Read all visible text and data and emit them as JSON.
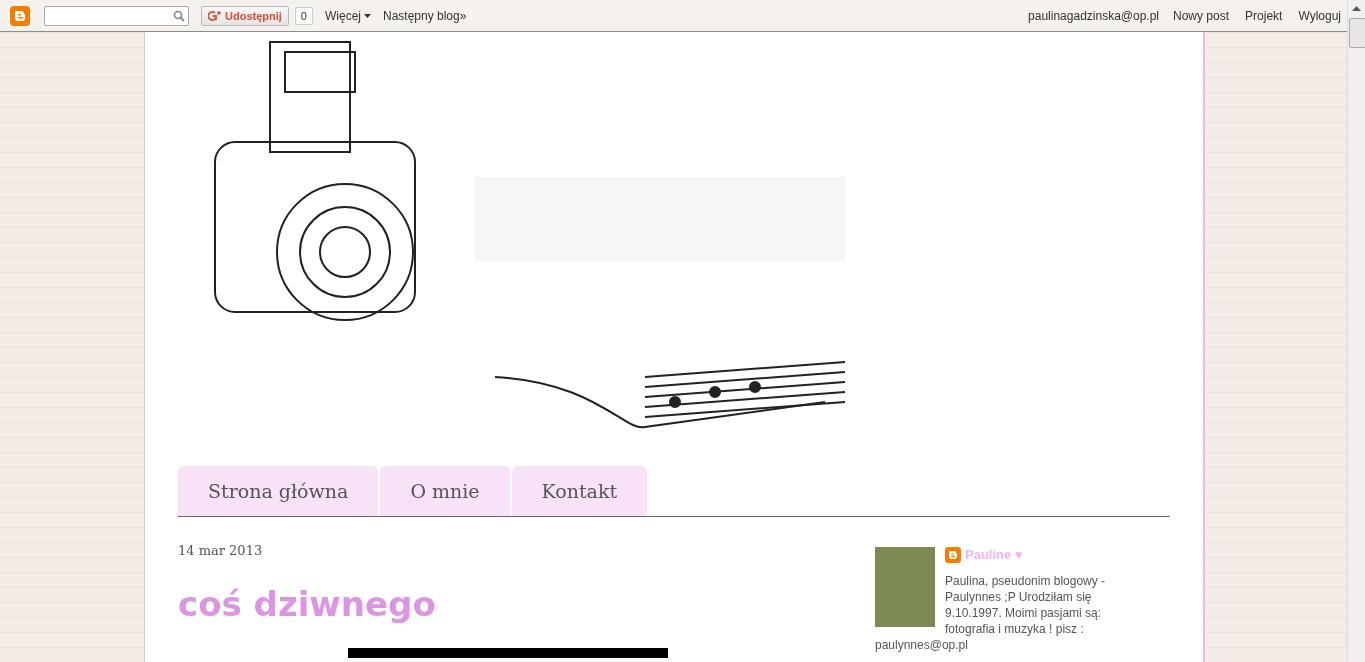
{
  "navbar": {
    "share_button": "Udostępnij",
    "share_count": "0",
    "more_menu": "Więcej",
    "next_blog": "Następny blog»",
    "user_email": "paulinagadzinska@op.pl",
    "links": [
      "Nowy post",
      "Projekt",
      "Wyloguj"
    ]
  },
  "tabs": [
    {
      "label": "Strona główna",
      "selected": false
    },
    {
      "label": "O mnie",
      "selected": false
    },
    {
      "label": "Kontakt",
      "selected": false
    }
  ],
  "post": {
    "date": "14 mar 2013",
    "title": "coś dziwnego"
  },
  "profile": {
    "name": "Pauline ♥",
    "bio": "Paulina, pseudonim blogowy - Paulynnes ;P Urodziłam się 9.10.1997. Moimi pasjami są: fotografia i muzyka ! pisz :",
    "email": "paulynnes@op.pl"
  }
}
